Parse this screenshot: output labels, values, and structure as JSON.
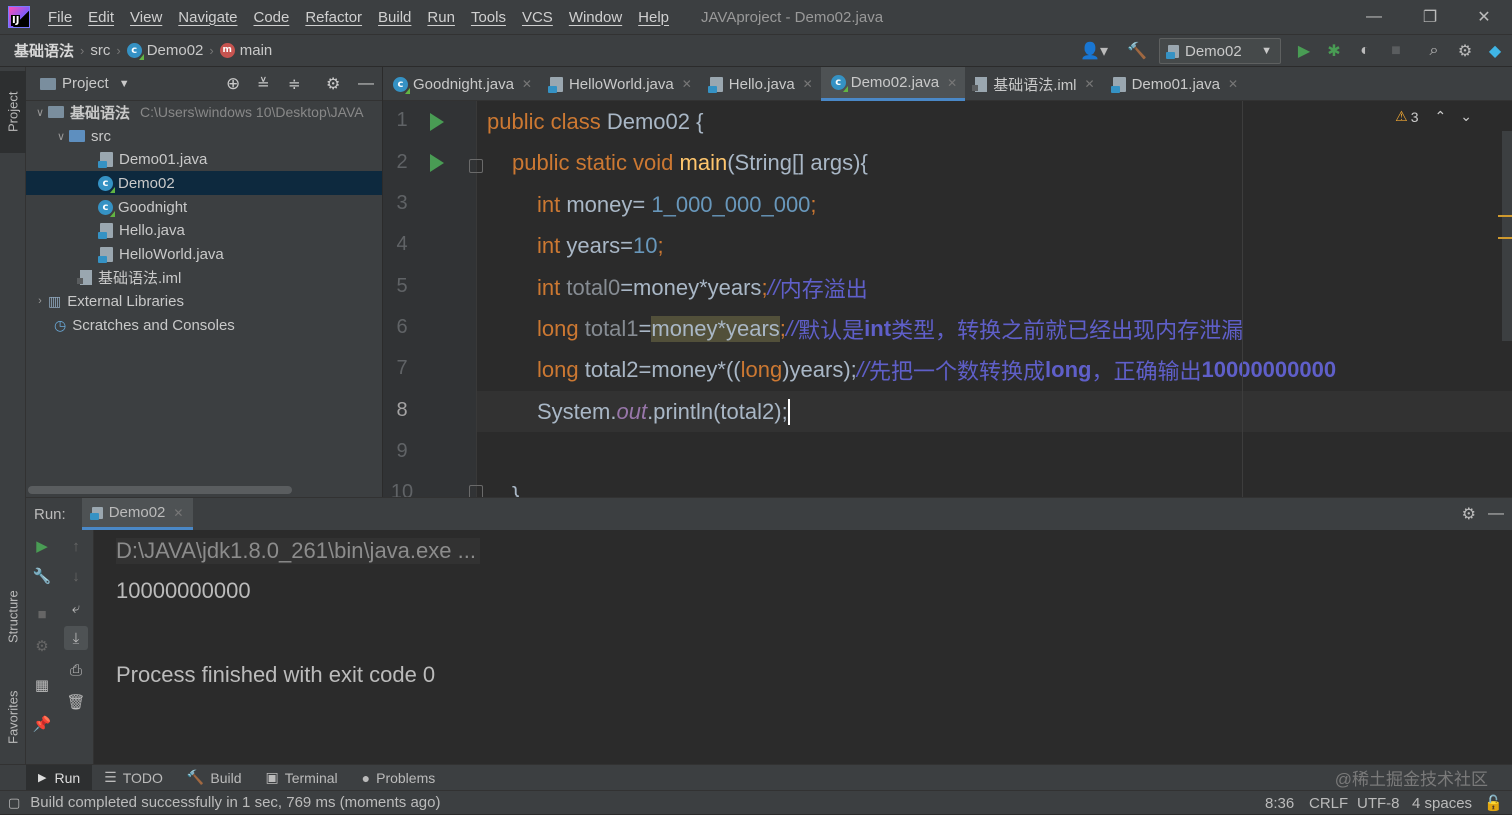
{
  "window": {
    "title": "JAVAproject - Demo02.java",
    "minimize": "—",
    "maximize": "❐",
    "close": "✕"
  },
  "menu": [
    "File",
    "Edit",
    "View",
    "Navigate",
    "Code",
    "Refactor",
    "Build",
    "Run",
    "Tools",
    "VCS",
    "Window",
    "Help"
  ],
  "breadcrumb": {
    "project": "基础语法",
    "src": "src",
    "class": "Demo02",
    "method": "main"
  },
  "toolbar": {
    "run_config": "Demo02"
  },
  "project_panel": {
    "title": "Project",
    "root": {
      "name": "基础语法",
      "path": "C:\\Users\\windows 10\\Desktop\\JAVA"
    },
    "src": "src",
    "files": [
      "Demo01.java",
      "Demo02",
      "Goodnight",
      "Hello.java",
      "HelloWorld.java"
    ],
    "iml": "基础语法.iml",
    "external": "External Libraries",
    "scratches": "Scratches and Consoles"
  },
  "side_tabs": {
    "project": "Project",
    "structure": "Structure",
    "favorites": "Favorites"
  },
  "editor_tabs": [
    "Goodnight.java",
    "HelloWorld.java",
    "Hello.java",
    "Demo02.java",
    "基础语法.iml",
    "Demo01.java"
  ],
  "editor": {
    "warnings": "3",
    "line_numbers": [
      "1",
      "2",
      "3",
      "4",
      "5",
      "6",
      "7",
      "8",
      "9",
      "10"
    ],
    "code": {
      "l1_kw": "public class ",
      "l1_name": "Demo02 {",
      "l2_kw": "public static void ",
      "l2_fn": "main",
      "l2_rest": "(String[] args){",
      "l3_kw": "int ",
      "l3_var": "money= ",
      "l3_num": "1_000_000_000",
      "l3_end": ";",
      "l4_kw": "int ",
      "l4_var": "years=",
      "l4_num": "10",
      "l4_end": ";",
      "l5_kw": "int ",
      "l5_var": "total0",
      "l5_expr": "=money*years",
      "l5_end": ";",
      "l5_cm": "//",
      "l5_cmtext": "内存溢出",
      "l6_kw": "long ",
      "l6_var": "total1",
      "l6_eq": "=",
      "l6_hl": "money*years",
      "l6_end": ";",
      "l6_cm": "//",
      "l6_c1": "默认是",
      "l6_c2": "int",
      "l6_c3": "类型，转换之前就已经出现内存泄漏",
      "l7_kw": "long ",
      "l7_var": "total2=money*((",
      "l7_kw2": "long",
      "l7_rest": ")years);",
      "l7_cm": "//",
      "l7_c1": "先把一个数转换成",
      "l7_c2": "long",
      "l7_c3": "，正确输出",
      "l7_c4": "10000000000",
      "l8_a": "System.",
      "l8_fld": "out",
      "l8_b": ".println(total2);",
      "l10": "}"
    }
  },
  "run": {
    "label": "Run:",
    "tab": "Demo02",
    "console": [
      "D:\\JAVA\\jdk1.8.0_261\\bin\\java.exe ...",
      "10000000000",
      "",
      "Process finished with exit code 0"
    ]
  },
  "bottom_tabs": [
    "Run",
    "TODO",
    "Build",
    "Terminal",
    "Problems"
  ],
  "status": {
    "message": "Build completed successfully in 1 sec, 769 ms (moments ago)",
    "position": "8:36",
    "line_sep": "CRLF",
    "encoding": "UTF-8",
    "indent": "4 spaces",
    "watermark": "@稀土掘金技术社区"
  }
}
